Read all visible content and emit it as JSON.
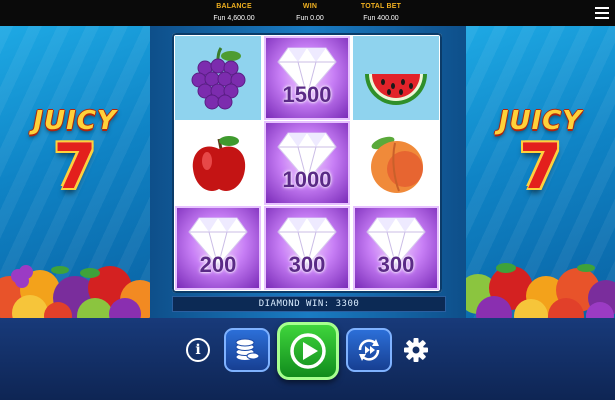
{
  "header": {
    "balance_label": "BALANCE",
    "balance_value": "Fun 4,600.00",
    "win_label": "WIN",
    "win_value": "Fun 0.00",
    "bet_label": "TOTAL BET",
    "bet_value": "Fun 400.00",
    "menu_icon": "hamburger-menu-icon"
  },
  "logo": {
    "word": "JUICY",
    "number": "7"
  },
  "reels": [
    [
      {
        "symbol": "grapes",
        "value": null
      },
      {
        "symbol": "apple",
        "value": null
      },
      {
        "symbol": "diamond",
        "value": "200"
      }
    ],
    [
      {
        "symbol": "diamond",
        "value": "1500"
      },
      {
        "symbol": "diamond",
        "value": "1000"
      },
      {
        "symbol": "diamond",
        "value": "300"
      }
    ],
    [
      {
        "symbol": "watermelon",
        "value": null
      },
      {
        "symbol": "peach",
        "value": null
      },
      {
        "symbol": "diamond",
        "value": "300"
      }
    ]
  ],
  "win_message": "DIAMOND WIN: 3300",
  "controls": {
    "info_icon": "info-icon",
    "info_glyph": "i",
    "coins_icon": "coin-stack-icon",
    "spin_icon": "play-spin-icon",
    "autoplay_icon": "autoplay-icon",
    "settings_icon": "gear-icon"
  },
  "colors": {
    "accent_gold": "#f0b020",
    "spin_green": "#2fbf2f",
    "diamond_purple": "#b465ee",
    "panel_blue": "#1294d8"
  }
}
